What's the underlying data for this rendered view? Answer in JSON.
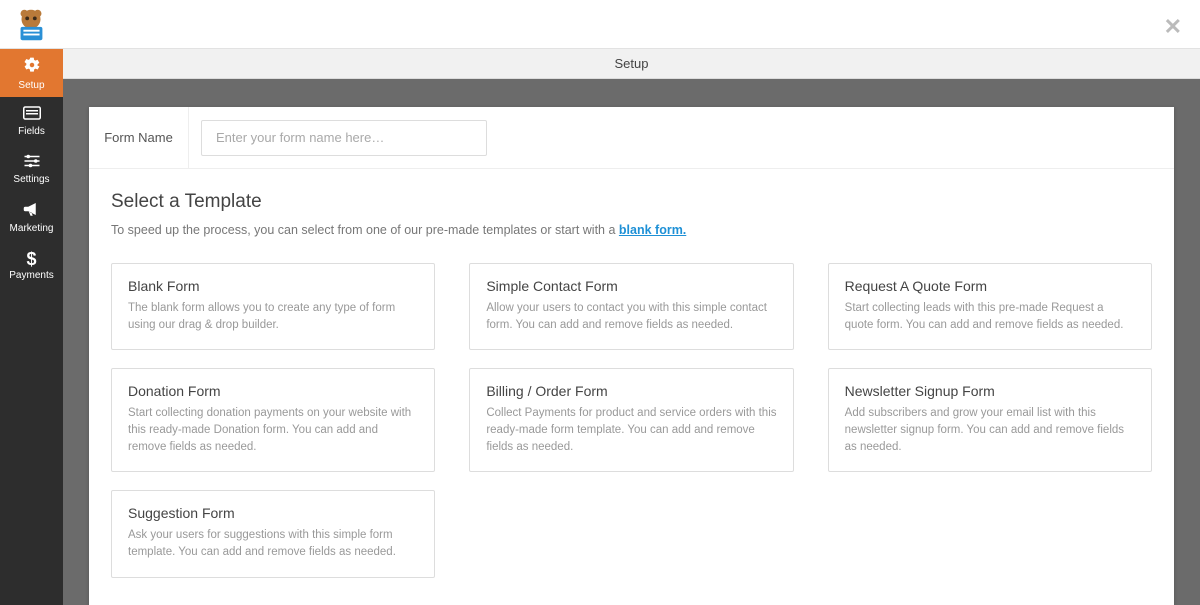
{
  "header": {
    "setup_strip": "Setup"
  },
  "sidebar": {
    "items": [
      {
        "label": "Setup",
        "icon": "⚙",
        "active": true
      },
      {
        "label": "Fields",
        "icon": "▭",
        "active": false
      },
      {
        "label": "Settings",
        "icon": "≡",
        "active": false
      },
      {
        "label": "Marketing",
        "icon": "📣",
        "active": false
      },
      {
        "label": "Payments",
        "icon": "$",
        "active": false
      }
    ]
  },
  "form_name": {
    "label": "Form Name",
    "placeholder": "Enter your form name here…",
    "value": ""
  },
  "template_section": {
    "heading": "Select a Template",
    "subtext_prefix": "To speed up the process, you can select from one of our pre-made templates or start with a ",
    "blank_link": "blank form."
  },
  "templates": [
    {
      "title": "Blank Form",
      "desc": "The blank form allows you to create any type of form using our drag & drop builder."
    },
    {
      "title": "Simple Contact Form",
      "desc": "Allow your users to contact you with this simple contact form. You can add and remove fields as needed."
    },
    {
      "title": "Request A Quote Form",
      "desc": "Start collecting leads with this pre-made Request a quote form. You can add and remove fields as needed."
    },
    {
      "title": "Donation Form",
      "desc": "Start collecting donation payments on your website with this ready-made Donation form. You can add and remove fields as needed."
    },
    {
      "title": "Billing / Order Form",
      "desc": "Collect Payments for product and service orders with this ready-made form template. You can add and remove fields as needed."
    },
    {
      "title": "Newsletter Signup Form",
      "desc": "Add subscribers and grow your email list with this newsletter signup form. You can add and remove fields as needed."
    },
    {
      "title": "Suggestion Form",
      "desc": "Ask your users for suggestions with this simple form template. You can add and remove fields as needed."
    }
  ]
}
